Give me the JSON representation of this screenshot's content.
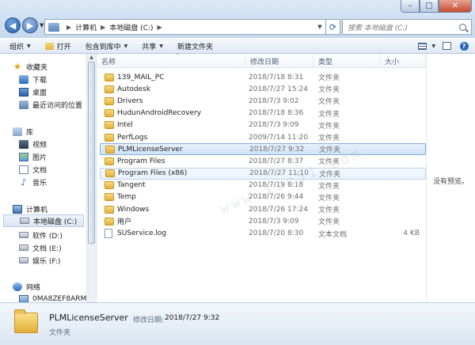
{
  "window": {
    "min_glyph": "–",
    "max_glyph": "□",
    "close_glyph": "✕"
  },
  "nav": {
    "back_glyph": "◀",
    "forward_glyph": "▶",
    "dropdown_glyph": "▼"
  },
  "address": {
    "crumbs": [
      "计算机",
      "本地磁盘 (C:)"
    ],
    "separator_glyph": "▶",
    "refresh_glyph": "⟳"
  },
  "search": {
    "placeholder": "搜索 本地磁盘 (C:)"
  },
  "toolbar": {
    "organize": "组织",
    "open": "打开",
    "include_in_library": "包含到库中",
    "share": "共享",
    "new_folder": "新建文件夹",
    "caret_glyph": "▼",
    "help_glyph": "?"
  },
  "sidebar": {
    "favorites": "收藏夹",
    "downloads": "下载",
    "desktop": "桌面",
    "recent": "最近访问的位置",
    "libraries": "库",
    "videos": "视频",
    "pictures": "图片",
    "documents": "文档",
    "music": "音乐",
    "computer": "计算机",
    "drive_c": "本地磁盘 (C:)",
    "drive_d": "软件 (D:)",
    "drive_e": "文档 (E:)",
    "drive_f": "娱乐 (F:)",
    "network": "网络",
    "net_pc": "0MA8ZEF8ARM"
  },
  "columns": {
    "name": "名称",
    "date": "修改日期",
    "type": "类型",
    "size": "大小"
  },
  "files": [
    {
      "name": "139_MAIL_PC",
      "date": "2018/7/18 8:31",
      "type": "文件夹",
      "size": ""
    },
    {
      "name": "Autodesk",
      "date": "2018/7/27 15:24",
      "type": "文件夹",
      "size": ""
    },
    {
      "name": "Drivers",
      "date": "2018/7/3 9:02",
      "type": "文件夹",
      "size": ""
    },
    {
      "name": "HudunAndroidRecovery",
      "date": "2018/7/18 8:36",
      "type": "文件夹",
      "size": ""
    },
    {
      "name": "Intel",
      "date": "2018/7/3 9:09",
      "type": "文件夹",
      "size": ""
    },
    {
      "name": "PerfLogs",
      "date": "2009/7/14 11:20",
      "type": "文件夹",
      "size": ""
    },
    {
      "name": "PLMLicenseServer",
      "date": "2018/7/27 9:32",
      "type": "文件夹",
      "size": ""
    },
    {
      "name": "Program Files",
      "date": "2018/7/27 8:37",
      "type": "文件夹",
      "size": ""
    },
    {
      "name": "Program Files (x86)",
      "date": "2018/7/27 11:10",
      "type": "文件夹",
      "size": ""
    },
    {
      "name": "Tangent",
      "date": "2018/7/19 8:18",
      "type": "文件夹",
      "size": ""
    },
    {
      "name": "Temp",
      "date": "2018/7/26 9:44",
      "type": "文件夹",
      "size": ""
    },
    {
      "name": "Windows",
      "date": "2018/7/26 17:24",
      "type": "文件夹",
      "size": ""
    },
    {
      "name": "用户",
      "date": "2018/7/3 9:09",
      "type": "文件夹",
      "size": ""
    },
    {
      "name": "SUService.log",
      "date": "2018/7/20 8:30",
      "type": "文本文档",
      "size": "4 KB"
    }
  ],
  "preview": {
    "message": "没有预览。"
  },
  "details": {
    "name": "PLMLicenseServer",
    "modified_label": "修改日期:",
    "modified": "2018/7/27 9:32",
    "type": "文件夹"
  },
  "watermark": "www.xue51.com"
}
